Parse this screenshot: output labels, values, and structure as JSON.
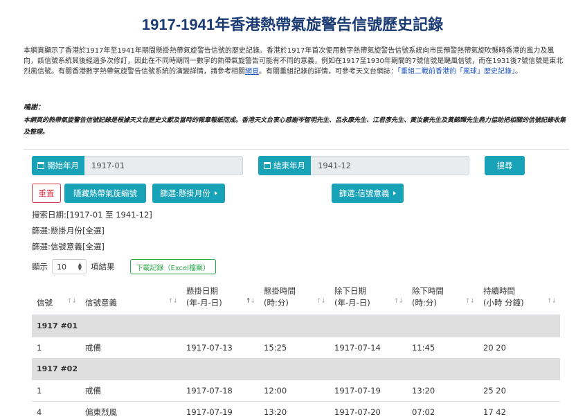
{
  "page": {
    "title": "1917-1941年香港熱帶氣旋警告信號歷史記錄",
    "intro_part1": "本網頁顯示了香港於1917年至1941年期間懸掛熱帶氣旋警告信號的歷史記錄。香港於1917年首次使用數字熱帶氣旋警告信號系統向市民預警熱帶氣旋吹襲時香港的風力及風向，該信號系統其後經過多次修訂，因此在不同時期同一數字的熱帶氣旋警告可能有不同的意義，例如在1917至1930年期間的7號信號是颶風信號，而在1931後7號信號是東北烈風信號。有關香港數字熱帶氣旋警告信號系統的演變詳情，請參考相關",
    "intro_link1": "網頁",
    "intro_part2": "。有關重組記錄的詳情，可參考天文台網誌：",
    "intro_link2": "「重組二戰前香港的「風球」歷史記錄」",
    "intro_part3": "。",
    "ack_title": "鳴謝：",
    "ack_text": "本網頁的熱帶氣旋警告信號記錄是根據天文台歷史文獻及當時的報章報紙而成。香港天文台衷心感謝岑智明先生、呂永康先生、江君彥先生、黃汝豪先生及黃錦輝先生鼎力協助把相關的信號記錄收集及整理。"
  },
  "form": {
    "start_label": "開始年月",
    "start_value": "1917-01",
    "end_label": "結束年月",
    "end_value": "1941-12",
    "search_label": "搜尋",
    "reset_label": "重置",
    "hide_label": "隱藏熱帶氣旋編號",
    "filter_month_label": "篩選:懸掛月份",
    "filter_signal_label": "篩選:信號意義"
  },
  "status": {
    "date_range": "搜索日期:[1917-01 至 1941-12]",
    "filter_month": "篩選:懸掛月份[全選]",
    "filter_signal": "篩選:信號意義[全選]"
  },
  "show_row": {
    "prefix": "顯示",
    "value": "10",
    "suffix": "項結果",
    "download_label": "下載記錄（Excel檔案）"
  },
  "table": {
    "headers": [
      {
        "line1": "信號",
        "line2": ""
      },
      {
        "line1": "信號意義",
        "line2": ""
      },
      {
        "line1": "懸掛日期",
        "line2": "(年-月-日)"
      },
      {
        "line1": "懸掛時間",
        "line2": "(時:分)"
      },
      {
        "line1": "除下日期",
        "line2": "(年-月-日)"
      },
      {
        "line1": "除下時間",
        "line2": "(時:分)"
      },
      {
        "line1": "持續時間",
        "line2": "(小時 分鐘)"
      }
    ],
    "groups": [
      {
        "name": "1917 #01",
        "rows": [
          {
            "signal": "1",
            "meaning": "戒備",
            "hoist_date": "1917-07-13",
            "hoist_time": "15:25",
            "lower_date": "1917-07-14",
            "lower_time": "11:45",
            "duration": "20 20"
          }
        ]
      },
      {
        "name": "1917 #02",
        "rows": [
          {
            "signal": "1",
            "meaning": "戒備",
            "hoist_date": "1917-07-18",
            "hoist_time": "12:00",
            "lower_date": "1917-07-19",
            "lower_time": "13:20",
            "duration": "25 20"
          },
          {
            "signal": "4",
            "meaning": "偏東烈風",
            "hoist_date": "1917-07-19",
            "hoist_time": "13:20",
            "lower_date": "1917-07-20",
            "lower_time": "07:02",
            "duration": "17 42"
          }
        ]
      }
    ]
  },
  "colors": {
    "title": "#1a3b73",
    "accent": "#17a2b8",
    "danger": "#dc3545",
    "success": "#28a745",
    "group_row": "#dedede"
  }
}
